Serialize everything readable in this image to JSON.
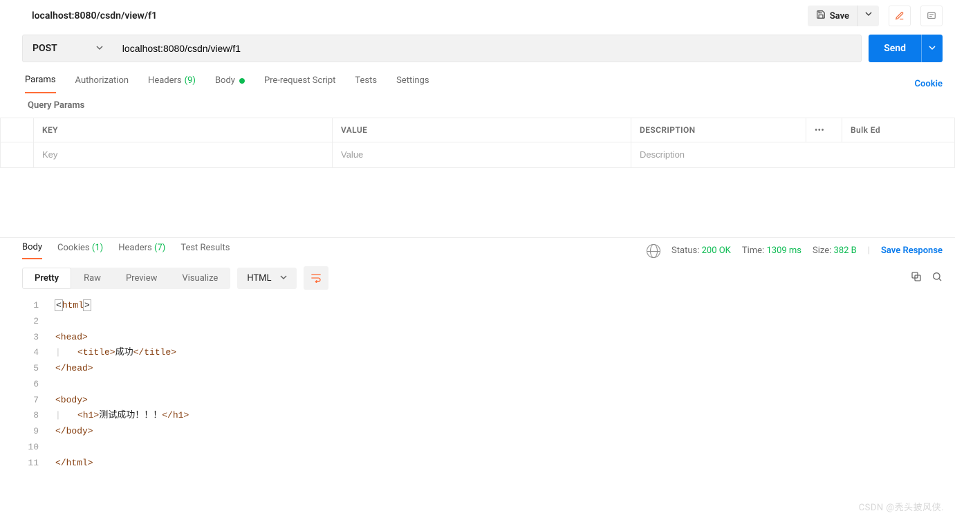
{
  "header": {
    "title": "localhost:8080/csdn/view/f1",
    "save_label": "Save"
  },
  "request": {
    "method": "POST",
    "url": "localhost:8080/csdn/view/f1",
    "send_label": "Send"
  },
  "tabs": {
    "params": "Params",
    "auth": "Authorization",
    "headers": "Headers",
    "headers_count": "(9)",
    "body": "Body",
    "prereq": "Pre-request Script",
    "tests": "Tests",
    "settings": "Settings",
    "cookies_link": "Cookie"
  },
  "params_section": {
    "title": "Query Params",
    "col_key": "KEY",
    "col_value": "VALUE",
    "col_desc": "DESCRIPTION",
    "bulk": "Bulk Ed",
    "ph_key": "Key",
    "ph_value": "Value",
    "ph_desc": "Description"
  },
  "response_tabs": {
    "body": "Body",
    "cookies": "Cookies",
    "cookies_count": "(1)",
    "headers": "Headers",
    "headers_count": "(7)",
    "tests": "Test Results"
  },
  "status": {
    "status_label": "Status:",
    "status_value": "200 OK",
    "time_label": "Time:",
    "time_value": "1309 ms",
    "size_label": "Size:",
    "size_value": "382 B",
    "save_response": "Save Response"
  },
  "view": {
    "pretty": "Pretty",
    "raw": "Raw",
    "preview": "Preview",
    "visualize": "Visualize",
    "format": "HTML"
  },
  "code": {
    "lines": [
      {
        "n": "1",
        "html": "<span class='hlbox'>&lt;</span><span class='tag-c'>html</span><span class='hlbox'>&gt;</span>"
      },
      {
        "n": "2",
        "html": ""
      },
      {
        "n": "3",
        "html": "<span class='tag-c'>&lt;head&gt;</span>"
      },
      {
        "n": "4",
        "html": "<span class='bar'>|</span><span class='tag-c'>&lt;title&gt;</span><span class='txt-c'>成功</span><span class='tag-c'>&lt;/title&gt;</span>"
      },
      {
        "n": "5",
        "html": "<span class='tag-c'>&lt;/head&gt;</span>"
      },
      {
        "n": "6",
        "html": ""
      },
      {
        "n": "7",
        "html": "<span class='tag-c'>&lt;body&gt;</span>"
      },
      {
        "n": "8",
        "html": "<span class='bar'>|</span><span class='tag-c'>&lt;h1&gt;</span><span class='txt-c'>测试成功！！！</span><span class='tag-c'>&lt;/h1&gt;</span>"
      },
      {
        "n": "9",
        "html": "<span class='tag-c'>&lt;/body&gt;</span>"
      },
      {
        "n": "10",
        "html": ""
      },
      {
        "n": "11",
        "html": "<span class='tag-c'>&lt;/html&gt;</span>"
      }
    ]
  },
  "watermark": "CSDN @秃头披风侠."
}
